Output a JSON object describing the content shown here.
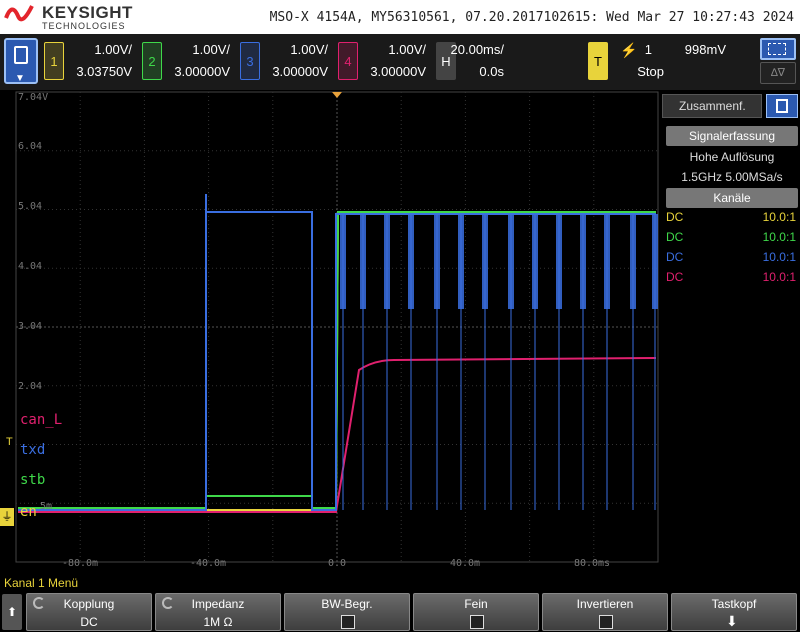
{
  "brand": {
    "name": "KEYSIGHT",
    "sub": "TECHNOLOGIES"
  },
  "device_info": "MSO-X 4154A, MY56310561, 07.20.2017102615: Wed Mar 27 10:27:43 2024",
  "channels": [
    {
      "num": "1",
      "scale": "1.00V/",
      "offset": "3.03750V",
      "color": "#e8d33b"
    },
    {
      "num": "2",
      "scale": "1.00V/",
      "offset": "3.00000V",
      "color": "#3fd84a"
    },
    {
      "num": "3",
      "scale": "1.00V/",
      "offset": "3.00000V",
      "color": "#3a6ee0"
    },
    {
      "num": "4",
      "scale": "1.00V/",
      "offset": "3.00000V",
      "color": "#e0206e"
    }
  ],
  "horizontal": {
    "label": "H",
    "timebase": "20.00ms/",
    "delay": "0.0s"
  },
  "trigger": {
    "label": "T",
    "source": "1",
    "level": "998mV",
    "status": "Stop"
  },
  "grid": {
    "volt_labels": [
      "7.04V",
      "6.04",
      "5.04",
      "4.04",
      "3.04",
      "2.04",
      "",
      "",
      "5m"
    ],
    "time_labels": [
      "-80.0m",
      "-40.0m",
      "0.0",
      "40.0m",
      "80.0ms"
    ]
  },
  "waveforms": {
    "labels": [
      {
        "text": "can_L",
        "color": "#e0206e"
      },
      {
        "text": "txd",
        "color": "#3a6ee0"
      },
      {
        "text": "stb",
        "color": "#3fd84a"
      },
      {
        "text": "en",
        "color": "#e8d33b"
      }
    ]
  },
  "panel": {
    "tab_label": "Zusammenf.",
    "acquisition_head": "Signalerfassung",
    "mode": "Hohe Auflösung",
    "rate": "1.5GHz   5.00MSa/s",
    "channels_head": "Kanäle",
    "channel_rows": [
      {
        "coupling": "DC",
        "probe": "10.0:1",
        "color": "#e8d33b"
      },
      {
        "coupling": "DC",
        "probe": "10.0:1",
        "color": "#3fd84a"
      },
      {
        "coupling": "DC",
        "probe": "10.0:1",
        "color": "#3a6ee0"
      },
      {
        "coupling": "DC",
        "probe": "10.0:1",
        "color": "#e0206e"
      }
    ]
  },
  "menu_title": "Kanal 1 Menü",
  "softkeys": [
    {
      "label": "Kopplung",
      "value": "DC"
    },
    {
      "label": "Impedanz",
      "value": "1M Ω"
    },
    {
      "label": "BW-Begr.",
      "value": ""
    },
    {
      "label": "Fein",
      "value": ""
    },
    {
      "label": "Invertieren",
      "value": ""
    },
    {
      "label": "Tastkopf",
      "value": ""
    }
  ]
}
